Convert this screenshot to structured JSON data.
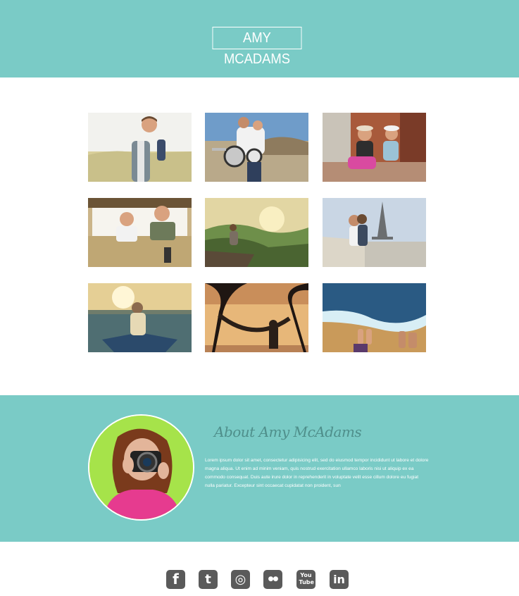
{
  "header": {
    "brand": "AMY MCADAMS"
  },
  "gallery": {
    "photos": [
      {
        "icon": "hiker-photo"
      },
      {
        "icon": "motorcycle-couple-photo"
      },
      {
        "icon": "bicycle-couple-photo"
      },
      {
        "icon": "safari-jeep-photo"
      },
      {
        "icon": "mountain-sunset-photo"
      },
      {
        "icon": "eiffel-tower-couple-photo"
      },
      {
        "icon": "boat-lake-photo"
      },
      {
        "icon": "hammock-sunset-photo"
      },
      {
        "icon": "beach-feet-photo"
      }
    ]
  },
  "about": {
    "title": "About Amy McAdams",
    "body": "Lorem ipsum dolor sit amet, consectetur adipisicing elit, sed do eiusmod tempor incididunt ut labore et dolore magna aliqua. Ut enim ad minim veniam, quis nostrud exercitation ullamco laboris nisi ut aliquip ex ea commodo consequat. Duis aute irure dolor in reprehenderit in voluptate velit esse cillum dolore eu fugiat nulla pariatur. Excepteur sint occaecat cupidatat non proident, sun"
  },
  "social": [
    {
      "icon": "facebook-icon",
      "glyph": "f"
    },
    {
      "icon": "twitter-icon",
      "glyph": "t"
    },
    {
      "icon": "instagram-icon",
      "glyph": "◎"
    },
    {
      "icon": "flickr-icon",
      "glyph": "●●"
    },
    {
      "icon": "youtube-icon",
      "glyph": "You Tube"
    },
    {
      "icon": "linkedin-icon",
      "glyph": "in"
    }
  ],
  "colors": {
    "teal": "#7acbc6",
    "title_teal": "#4f8f8b",
    "icon_gray": "#5a5a5a",
    "white": "#ffffff"
  }
}
